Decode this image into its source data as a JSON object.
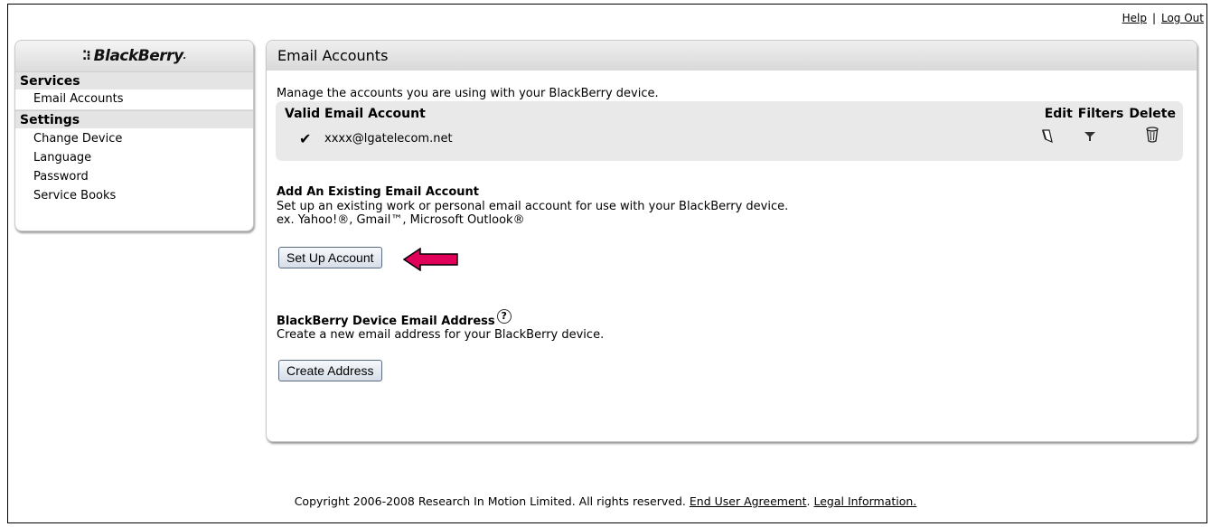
{
  "top_links": {
    "help": "Help",
    "separator": "|",
    "logout": "Log Out"
  },
  "sidebar": {
    "logo": {
      "dots": "⁚⁝",
      "name": "BlackBerry",
      "suffix": "."
    },
    "services": {
      "header": "Services",
      "items": [
        {
          "label": "Email Accounts",
          "active": true
        }
      ]
    },
    "settings": {
      "header": "Settings",
      "items": [
        {
          "label": "Change Device"
        },
        {
          "label": "Language"
        },
        {
          "label": "Password"
        },
        {
          "label": "Service Books"
        }
      ]
    }
  },
  "main": {
    "title": "Email Accounts",
    "intro": "Manage the accounts you are using with your BlackBerry device.",
    "accounts_table": {
      "header": "Valid Email Account",
      "columns": [
        "Edit",
        "Filters",
        "Delete"
      ],
      "rows": [
        {
          "check": "✔",
          "email": "xxxx@lgatelecom.net",
          "edit_icon": "pencil-icon",
          "filter_icon": "filter-icon",
          "delete_icon": "trash-icon"
        }
      ]
    },
    "add_existing": {
      "title": "Add An Existing Email Account",
      "line1": "Set up an existing work or personal email account for use with your BlackBerry device.",
      "line2": "ex. Yahoo!®, Gmail™, Microsoft Outlook®",
      "button": "Set Up Account"
    },
    "device_address": {
      "title": "BlackBerry Device Email Address",
      "help_glyph": "?",
      "text": "Create a new email address for your BlackBerry device.",
      "button": "Create Address"
    }
  },
  "footer": {
    "text": "Copyright 2006-2008 Research In Motion Limited. All rights reserved.",
    "eua": "End User Agreement",
    "period": ".",
    "legal": "Legal Information."
  },
  "colors": {
    "arrow": "#e0005a",
    "panel_bg": "#e9e9e9",
    "button_border": "#5a6a82"
  }
}
